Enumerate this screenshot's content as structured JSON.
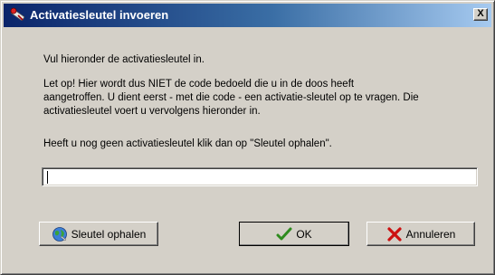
{
  "window": {
    "title": "Activatiesleutel invoeren",
    "close_glyph": "X"
  },
  "body": {
    "instruction": "Vul hieronder de activatiesleutel in.",
    "warning_lines": [
      "Let op! Hier wordt dus NIET de code bedoeld die u in de doos heeft",
      "aangetroffen. U dient eerst - met die code - een activatie-sleutel op te vragen. Die",
      "activatiesleutel voert u vervolgens hieronder in."
    ],
    "hint": "Heeft u nog geen activatiesleutel klik dan op \"Sleutel ophalen\"."
  },
  "key_input": {
    "value": "",
    "placeholder": ""
  },
  "buttons": {
    "fetch": {
      "label": "Sleutel ophalen",
      "icon": "globe-icon"
    },
    "ok": {
      "label": "OK",
      "icon": "checkmark-icon"
    },
    "cancel": {
      "label": "Annuleren",
      "icon": "red-x-icon"
    }
  },
  "colors": {
    "titlebar_start": "#0a246a",
    "titlebar_end": "#a6caf0",
    "face": "#d4d0c8",
    "ok_check": "#2e8b1e",
    "cancel_x": "#cc1111"
  }
}
